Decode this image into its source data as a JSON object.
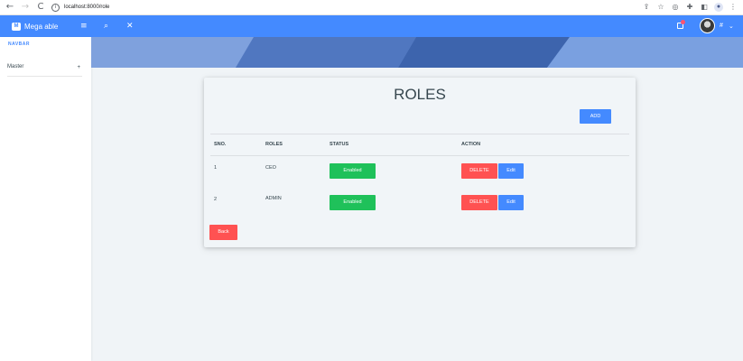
{
  "browser": {
    "url": "localhost:8000/role",
    "back_glyph": "←",
    "forward_glyph": "→",
    "reload_glyph": "C",
    "info_glyph": "i",
    "right_icons": [
      "share-icon",
      "star-icon",
      "extension-icon",
      "puzzle-icon",
      "sidebar-icon"
    ],
    "profile_glyph": "●",
    "menu_glyph": "⋮"
  },
  "header": {
    "logo_letter": "M",
    "brand": "Mega able",
    "hamburger_glyph": "≡",
    "search_glyph": "⌕",
    "expand_glyph": "✕",
    "user_name": "#",
    "caret_glyph": "⌄",
    "accent": "#448aff"
  },
  "sidebar": {
    "title": "NAVBAR",
    "items": [
      {
        "label": "Master",
        "expand_glyph": "+"
      }
    ]
  },
  "main": {
    "title": "ROLES",
    "add_label": "ADD",
    "columns": [
      "SNO.",
      "ROLES",
      "STATUS",
      "ACTION"
    ],
    "rows": [
      {
        "sno": "1",
        "role": "CEO",
        "status": "Enabled",
        "delete": "DELETE",
        "edit": "Edit"
      },
      {
        "sno": "2",
        "role": "ADMIN",
        "status": "Enabled",
        "delete": "DELETE",
        "edit": "Edit"
      }
    ],
    "back_label": "Back"
  },
  "colors": {
    "primary": "#448aff",
    "success": "#1fc15a",
    "danger": "#ff5252"
  }
}
